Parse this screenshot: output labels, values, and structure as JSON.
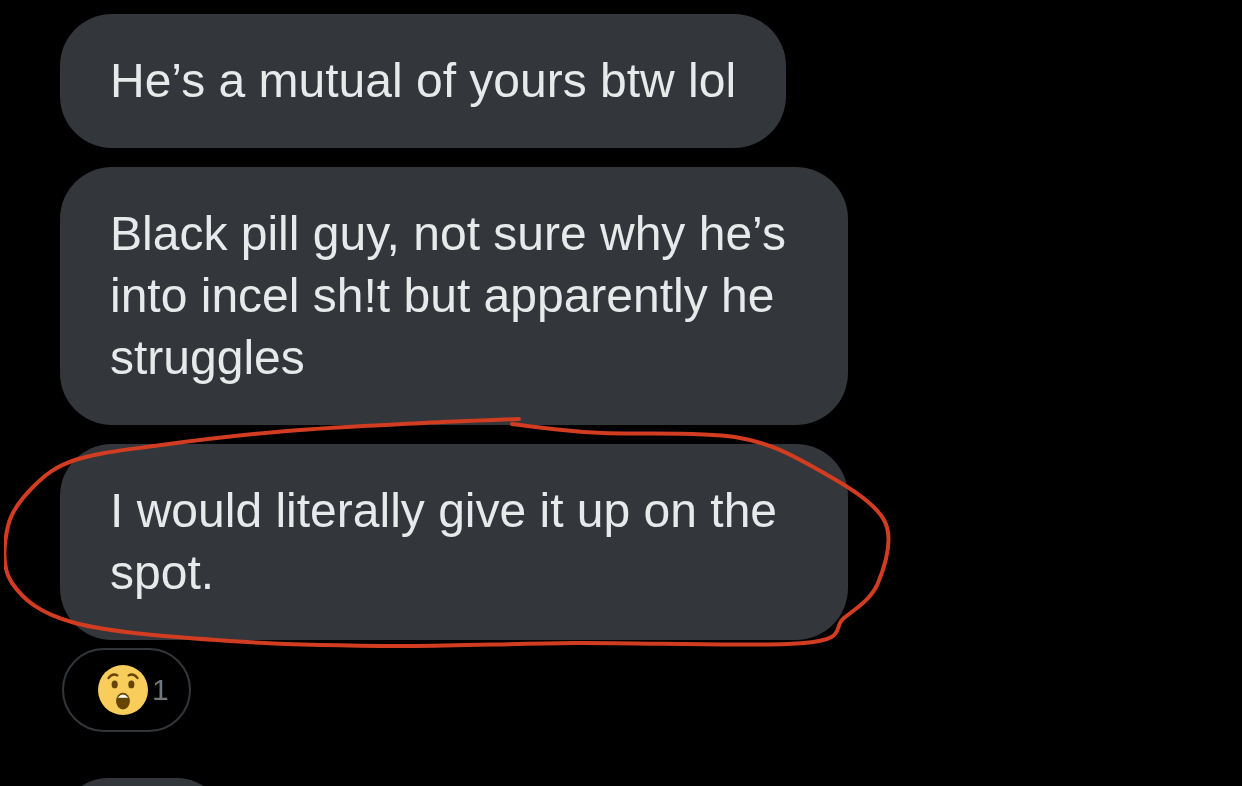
{
  "messages": [
    {
      "kind": "text",
      "text": "He’s a mutual of yours btw lol",
      "circled": false
    },
    {
      "kind": "text",
      "text": "Black pill guy, not sure why he’s into incel sh!t but apparently he struggles",
      "circled": false
    },
    {
      "kind": "text",
      "text": "I would literally give it up on the spot.",
      "circled": true,
      "reactions": [
        {
          "count": "1"
        }
      ]
    },
    {
      "kind": "clipped",
      "circled": false
    }
  ]
}
